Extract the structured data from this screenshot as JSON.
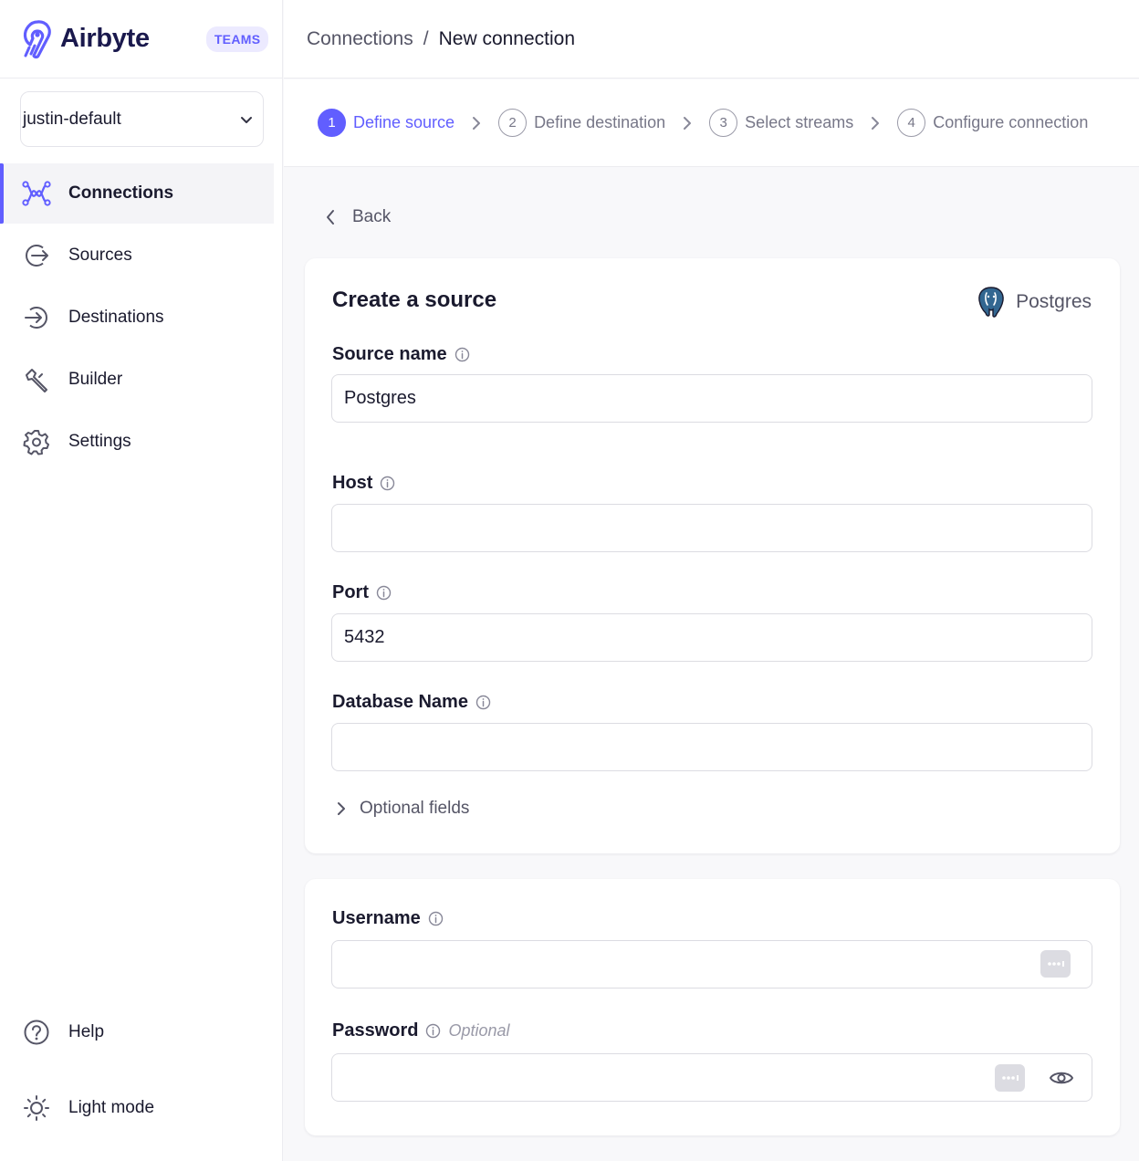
{
  "brand": {
    "name": "Airbyte",
    "badge": "TEAMS",
    "accent": "#615eff"
  },
  "workspace": {
    "name": "justin-default"
  },
  "nav": {
    "items": [
      {
        "label": "Connections",
        "icon": "connections-icon",
        "active": true
      },
      {
        "label": "Sources",
        "icon": "sources-icon"
      },
      {
        "label": "Destinations",
        "icon": "destinations-icon"
      },
      {
        "label": "Builder",
        "icon": "builder-icon"
      },
      {
        "label": "Settings",
        "icon": "settings-icon"
      }
    ],
    "bottom": [
      {
        "label": "Help",
        "icon": "help-icon"
      },
      {
        "label": "Light mode",
        "icon": "sun-icon"
      }
    ]
  },
  "breadcrumb": {
    "parent": "Connections",
    "separator": "/",
    "current": "New connection"
  },
  "stepper": {
    "steps": [
      {
        "num": "1",
        "label": "Define source",
        "active": true
      },
      {
        "num": "2",
        "label": "Define destination"
      },
      {
        "num": "3",
        "label": "Select streams"
      },
      {
        "num": "4",
        "label": "Configure connection"
      }
    ]
  },
  "back": {
    "label": "Back"
  },
  "form": {
    "title": "Create a source",
    "source_type": "Postgres",
    "source_name": {
      "label": "Source name",
      "value": "Postgres"
    },
    "host": {
      "label": "Host",
      "value": ""
    },
    "port": {
      "label": "Port",
      "value": "5432"
    },
    "database": {
      "label": "Database Name",
      "value": ""
    },
    "optional_fields": "Optional fields",
    "username": {
      "label": "Username",
      "value": ""
    },
    "password": {
      "label": "Password",
      "value": "",
      "optional": "Optional"
    }
  }
}
